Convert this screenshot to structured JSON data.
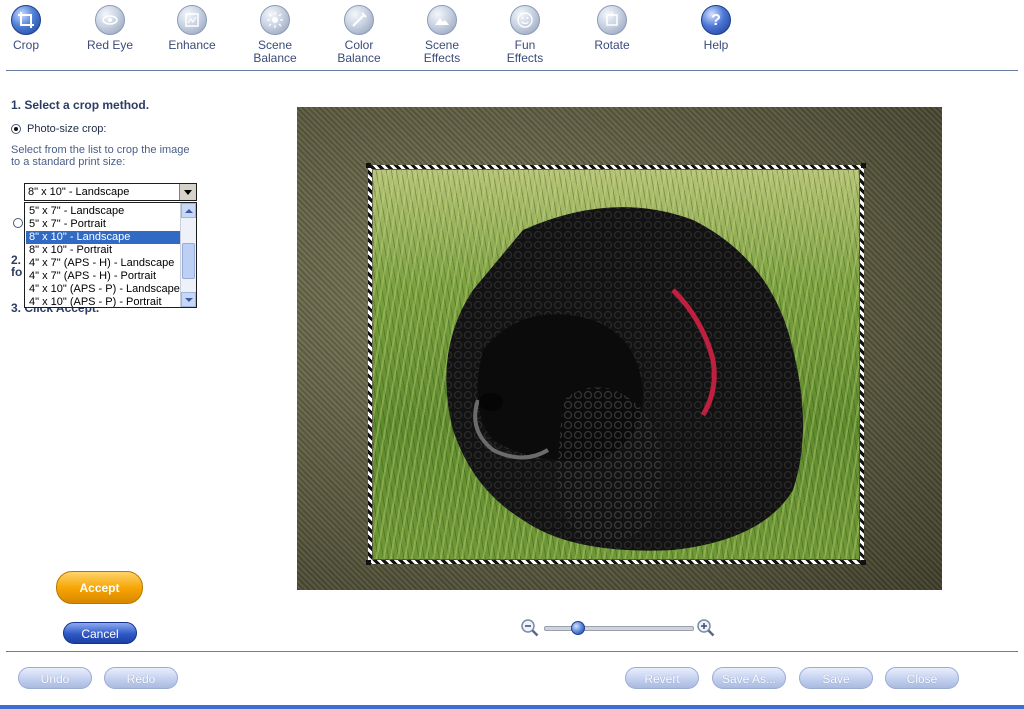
{
  "toolbar": {
    "tools": [
      {
        "label": "Crop",
        "icon": "crop-icon"
      },
      {
        "label": "Red Eye",
        "icon": "eye-icon"
      },
      {
        "label": "Enhance",
        "icon": "enhance-icon"
      },
      {
        "label": "Scene\nBalance",
        "icon": "scene-balance-icon"
      },
      {
        "label": "Color\nBalance",
        "icon": "color-balance-icon"
      },
      {
        "label": "Scene\nEffects",
        "icon": "scene-effects-icon"
      },
      {
        "label": "Fun\nEffects",
        "icon": "smiley-icon"
      },
      {
        "label": "Rotate",
        "icon": "rotate-icon"
      },
      {
        "label": "Help",
        "icon": "help-icon",
        "glyph": "?"
      }
    ]
  },
  "left_panel": {
    "step1": "1. Select a crop method.",
    "photo_size_crop_label": "Photo-size crop:",
    "help_text": "Select from the list to crop the image\nto a standard print size:",
    "combo_value": "8\" x 10\" - Landscape",
    "options": [
      "5\" x 7\" - Landscape",
      "5\" x 7\" - Portrait",
      "8\" x 10\" - Landscape",
      "8\" x 10\" - Portrait",
      "4\" x 7\" (APS - H) - Landscape",
      "4\" x 7\" (APS - H) - Portrait",
      "4\" x 10\" (APS - P) - Landscape",
      "4\" x 10\" (APS - P) - Portrait"
    ],
    "selected_index": 2,
    "step2_partial": "2.",
    "step2_partial_line2": "fo",
    "step3_partial": "3. Click Accept."
  },
  "actions": {
    "accept": "Accept",
    "cancel": "Cancel"
  },
  "zoom": {
    "level": 0.2
  },
  "footer": {
    "undo": "Undo",
    "redo": "Redo",
    "revert": "Revert",
    "save_as": "Save As...",
    "save": "Save",
    "close": "Close"
  },
  "colors": {
    "accent_blue": "#316ac5",
    "accept_orange": "#f5a300",
    "cancel_blue": "#2f59c8"
  }
}
